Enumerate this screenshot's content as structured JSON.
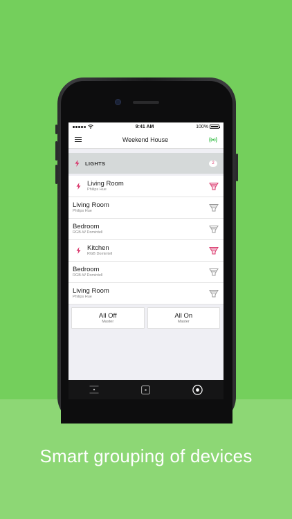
{
  "status_bar": {
    "time": "9:41 AM",
    "battery": "100%"
  },
  "header": {
    "title": "Weekend House"
  },
  "section": {
    "title": "LIGHTS",
    "count": "2"
  },
  "devices": [
    {
      "name": "Living Room",
      "type": "Philips Hue",
      "active": true
    },
    {
      "name": "Living Room",
      "type": "Philips Hue",
      "active": false
    },
    {
      "name": "Bedroom",
      "type": "RGB-W Domintell",
      "active": false
    },
    {
      "name": "Kitchen",
      "type": "RGB Domintell",
      "active": true
    },
    {
      "name": "Bedroom",
      "type": "RGB-W Domintell",
      "active": false
    },
    {
      "name": "Living Room",
      "type": "Philips Hue",
      "active": false
    }
  ],
  "master_buttons": {
    "off": {
      "label": "All Off",
      "sub": "Master"
    },
    "on": {
      "label": "All On",
      "sub": "Master"
    }
  },
  "caption": "Smart grouping of devices",
  "colors": {
    "accent": "#d9366b",
    "background": "#74cf5c",
    "connected": "#3fbf4f"
  },
  "icons": [
    "menu-icon",
    "connection-icon",
    "bolt-icon",
    "bulb-icon",
    "list-icon",
    "home-icon",
    "target-icon"
  ]
}
